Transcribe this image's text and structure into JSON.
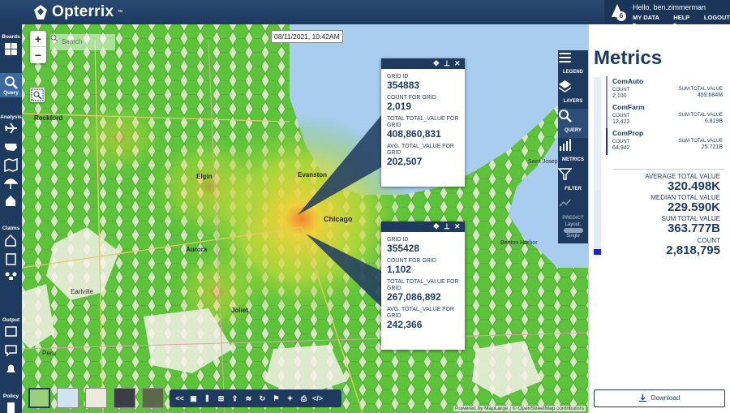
{
  "app": {
    "name": "Opterrix",
    "trademark": "™"
  },
  "user": {
    "greeting": "Hello, ben.zimmerman",
    "notifications": "6",
    "menu": [
      "MY DATA",
      "HELP",
      "LOGOUT"
    ]
  },
  "sidebar": {
    "sections": [
      "Boards",
      "Query",
      "Analysis",
      "Claims",
      "Output",
      "Policy"
    ]
  },
  "map": {
    "timestamp": "08/11/2021, 10:42AM",
    "search_placeholder": "Search",
    "zoom_in": "+",
    "zoom_out": "−",
    "place_labels": [
      "Rockford",
      "Elgin",
      "Evanston",
      "Chicago",
      "Aurora",
      "Joliet",
      "Earlville",
      "Peru",
      "Saint Joseph",
      "Benton Harbor"
    ],
    "attribution": "Powered by MapLarge | © OpenStreetMap contributors",
    "colors": {
      "low": "#5cc33a",
      "mid": "#b7d83a",
      "high": "#f2d23a",
      "hot": "#f3842f",
      "water": "#a9cdee"
    }
  },
  "popups": [
    {
      "fields": [
        {
          "label": "GRID ID",
          "value": "354883"
        },
        {
          "label": "COUNT FOR GRID",
          "value": "2,019"
        },
        {
          "label": "TOTAL TOTAL_VALUE FOR GRID",
          "value": "408,860,831"
        },
        {
          "label": "AVG. TOTAL_VALUE FOR GRID",
          "value": "202,507"
        }
      ]
    },
    {
      "fields": [
        {
          "label": "GRID ID",
          "value": "355428"
        },
        {
          "label": "COUNT FOR GRID",
          "value": "1,102"
        },
        {
          "label": "TOTAL TOTAL_VALUE FOR GRID",
          "value": "267,086,892"
        },
        {
          "label": "AVG. TOTAL_VALUE FOR GRID",
          "value": "242,366"
        }
      ]
    }
  ],
  "right_tools": [
    {
      "label": "LEGEND",
      "icon": "legend-icon"
    },
    {
      "label": "LAYERS",
      "icon": "layers-icon"
    },
    {
      "label": "QUERY",
      "icon": "query-icon"
    },
    {
      "label": "METRICS",
      "icon": "metrics-icon"
    },
    {
      "label": "FILTER",
      "icon": "filter-icon"
    },
    {
      "label": "PREDICT",
      "icon": "predict-icon"
    }
  ],
  "layout_toggle": {
    "label": "Layout:",
    "value": "Single"
  },
  "bottom_toolbar": {
    "collapse": "<<",
    "code": "</>"
  },
  "metrics": {
    "title": "Metrics",
    "cards": [
      {
        "name": "ComAuto",
        "count_label": "COUNT",
        "count": "2,100",
        "sum_label": "SUM TOTAL VALUE",
        "sum": "459.684M"
      },
      {
        "name": "ComFarm",
        "count_label": "COUNT",
        "count": "12,422",
        "sum_label": "SUM TOTAL VALUE",
        "sum": "6.819B"
      },
      {
        "name": "ComProp",
        "count_label": "COUNT",
        "count": "64,942",
        "sum_label": "SUM TOTAL VALUE",
        "sum": "25.721B"
      }
    ],
    "stats": [
      {
        "label": "AVERAGE TOTAL VALUE",
        "value": "320.498K"
      },
      {
        "label": "MEDIAN TOTAL VALUE",
        "value": "229.590K"
      },
      {
        "label": "SUM TOTAL VALUE",
        "value": "363.777B"
      },
      {
        "label": "COUNT",
        "value": "2,818,795"
      }
    ],
    "download_label": "Download"
  }
}
